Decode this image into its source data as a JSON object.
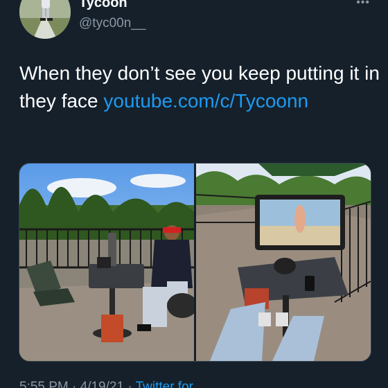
{
  "author": {
    "display_name": "Tycoon",
    "handle": "@tyc00n__"
  },
  "tweet": {
    "text": "When they don’t see you keep putting it in they face ",
    "link": "youtube.com/c/Tycoonn"
  },
  "media": {
    "photos": [
      {
        "description_icon": "photo-icon"
      },
      {
        "description_icon": "photo-icon"
      }
    ]
  },
  "footer": {
    "time": "5:55 PM · 4/19/21 · ",
    "source": "Twitter for"
  },
  "colors": {
    "background": "#15202b",
    "accent": "#1d9bf0",
    "secondary_text": "#8b98a5"
  }
}
